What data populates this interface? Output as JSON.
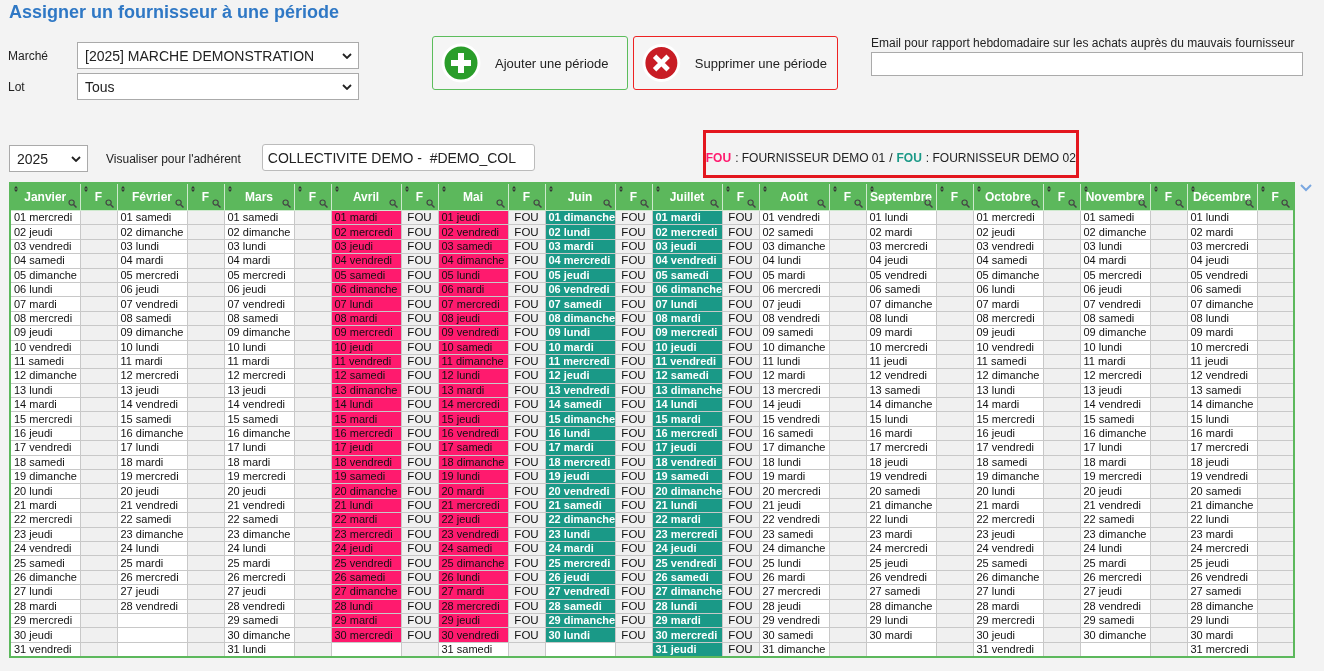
{
  "title": "Assigner un fournisseur à une période",
  "marche": {
    "label": "Marché",
    "value": "[2025] MARCHE DEMONSTRATION"
  },
  "lot": {
    "label": "Lot",
    "value": "Tous"
  },
  "buttons": [
    {
      "kind": "add",
      "label": "Ajouter une période"
    },
    {
      "kind": "remove",
      "label": "Supprimer une période"
    }
  ],
  "email": {
    "label": "Email pour rapport hebdomadaire sur les achats auprès du mauvais fournisseur"
  },
  "year": {
    "value": "2025"
  },
  "adherent": {
    "label": "Visualiser pour l'adhérent",
    "value": "COLLECTIVITE DEMO -  #DEMO_COL"
  },
  "legend": {
    "separator": "/",
    "items": [
      {
        "code": "FOU",
        "color": "#ff1a6e",
        "name": ": FOURNISSEUR DEMO 01"
      },
      {
        "code": "FOU",
        "color": "#1a9987",
        "name": ": FOURNISSEUR DEMO 02"
      }
    ]
  },
  "months": [
    {
      "name": "Janvier",
      "f_header": "F",
      "days": [
        "01 mercredi",
        "02 jeudi",
        "03 vendredi",
        "04 samedi",
        "05 dimanche",
        "06 lundi",
        "07 mardi",
        "08 mercredi",
        "09 jeudi",
        "10 vendredi",
        "11 samedi",
        "12 dimanche",
        "13 lundi",
        "14 mardi",
        "15 mercredi",
        "16 jeudi",
        "17 vendredi",
        "18 samedi",
        "19 dimanche",
        "20 lundi",
        "21 mardi",
        "22 mercredi",
        "23 jeudi",
        "24 vendredi",
        "25 samedi",
        "26 dimanche",
        "27 lundi",
        "28 mardi",
        "29 mercredi",
        "30 jeudi",
        "31 vendredi"
      ]
    },
    {
      "name": "Février",
      "f_header": "F",
      "days": [
        "01 samedi",
        "02 dimanche",
        "03 lundi",
        "04 mardi",
        "05 mercredi",
        "06 jeudi",
        "07 vendredi",
        "08 samedi",
        "09 dimanche",
        "10 lundi",
        "11 mardi",
        "12 mercredi",
        "13 jeudi",
        "14 vendredi",
        "15 samedi",
        "16 dimanche",
        "17 lundi",
        "18 mardi",
        "19 mercredi",
        "20 jeudi",
        "21 vendredi",
        "22 samedi",
        "23 dimanche",
        "24 lundi",
        "25 mardi",
        "26 mercredi",
        "27 jeudi",
        "28 vendredi"
      ]
    },
    {
      "name": "Mars",
      "f_header": "F",
      "days": [
        "01 samedi",
        "02 dimanche",
        "03 lundi",
        "04 mardi",
        "05 mercredi",
        "06 jeudi",
        "07 vendredi",
        "08 samedi",
        "09 dimanche",
        "10 lundi",
        "11 mardi",
        "12 mercredi",
        "13 jeudi",
        "14 vendredi",
        "15 samedi",
        "16 dimanche",
        "17 lundi",
        "18 mardi",
        "19 mercredi",
        "20 jeudi",
        "21 vendredi",
        "22 samedi",
        "23 dimanche",
        "24 lundi",
        "25 mardi",
        "26 mercredi",
        "27 jeudi",
        "28 vendredi",
        "29 samedi",
        "30 dimanche",
        "31 lundi"
      ]
    },
    {
      "name": "Avril",
      "f_header": "F",
      "color": "#ff1a6e",
      "days": [
        "01 mardi",
        "02 mercredi",
        "03 jeudi",
        "04 vendredi",
        "05 samedi",
        "06 dimanche",
        "07 lundi",
        "08 mardi",
        "09 mercredi",
        "10 jeudi",
        "11 vendredi",
        "12 samedi",
        "13 dimanche",
        "14 lundi",
        "15 mardi",
        "16 mercredi",
        "17 jeudi",
        "18 vendredi",
        "19 samedi",
        "20 dimanche",
        "21 lundi",
        "22 mardi",
        "23 mercredi",
        "24 jeudi",
        "25 vendredi",
        "26 samedi",
        "27 dimanche",
        "28 lundi",
        "29 mardi",
        "30 mercredi"
      ],
      "assigned": [
        "FOU",
        "FOU",
        "FOU",
        "FOU",
        "FOU",
        "FOU",
        "FOU",
        "FOU",
        "FOU",
        "FOU",
        "FOU",
        "FOU",
        "FOU",
        "FOU",
        "FOU",
        "FOU",
        "FOU",
        "FOU",
        "FOU",
        "FOU",
        "FOU",
        "FOU",
        "FOU",
        "FOU",
        "FOU",
        "FOU",
        "FOU",
        "FOU",
        "FOU",
        "FOU"
      ]
    },
    {
      "name": "Mai",
      "f_header": "F",
      "color": "#ff1a6e",
      "days": [
        "01 jeudi",
        "02 vendredi",
        "03 samedi",
        "04 dimanche",
        "05 lundi",
        "06 mardi",
        "07 mercredi",
        "08 jeudi",
        "09 vendredi",
        "10 samedi",
        "11 dimanche",
        "12 lundi",
        "13 mardi",
        "14 mercredi",
        "15 jeudi",
        "16 vendredi",
        "17 samedi",
        "18 dimanche",
        "19 lundi",
        "20 mardi",
        "21 mercredi",
        "22 jeudi",
        "23 vendredi",
        "24 samedi",
        "25 dimanche",
        "26 lundi",
        "27 mardi",
        "28 mercredi",
        "29 jeudi",
        "30 vendredi",
        "31 samedi"
      ],
      "assigned": [
        "FOU",
        "FOU",
        "FOU",
        "FOU",
        "FOU",
        "FOU",
        "FOU",
        "FOU",
        "FOU",
        "FOU",
        "FOU",
        "FOU",
        "FOU",
        "FOU",
        "FOU",
        "FOU",
        "FOU",
        "FOU",
        "FOU",
        "FOU",
        "FOU",
        "FOU",
        "FOU",
        "FOU",
        "FOU",
        "FOU",
        "FOU",
        "FOU",
        "FOU",
        "FOU"
      ]
    },
    {
      "name": "Juin",
      "f_header": "F",
      "color": "#1a9987",
      "days": [
        "01 dimanche",
        "02 lundi",
        "03 mardi",
        "04 mercredi",
        "05 jeudi",
        "06 vendredi",
        "07 samedi",
        "08 dimanche",
        "09 lundi",
        "10 mardi",
        "11 mercredi",
        "12 jeudi",
        "13 vendredi",
        "14 samedi",
        "15 dimanche",
        "16 lundi",
        "17 mardi",
        "18 mercredi",
        "19 jeudi",
        "20 vendredi",
        "21 samedi",
        "22 dimanche",
        "23 lundi",
        "24 mardi",
        "25 mercredi",
        "26 jeudi",
        "27 vendredi",
        "28 samedi",
        "29 dimanche",
        "30 lundi"
      ],
      "assigned": [
        "FOU",
        "FOU",
        "FOU",
        "FOU",
        "FOU",
        "FOU",
        "FOU",
        "FOU",
        "FOU",
        "FOU",
        "FOU",
        "FOU",
        "FOU",
        "FOU",
        "FOU",
        "FOU",
        "FOU",
        "FOU",
        "FOU",
        "FOU",
        "FOU",
        "FOU",
        "FOU",
        "FOU",
        "FOU",
        "FOU",
        "FOU",
        "FOU",
        "FOU",
        "FOU"
      ]
    },
    {
      "name": "Juillet",
      "f_header": "F",
      "color": "#1a9987",
      "days": [
        "01 mardi",
        "02 mercredi",
        "03 jeudi",
        "04 vendredi",
        "05 samedi",
        "06 dimanche",
        "07 lundi",
        "08 mardi",
        "09 mercredi",
        "10 jeudi",
        "11 vendredi",
        "12 samedi",
        "13 dimanche",
        "14 lundi",
        "15 mardi",
        "16 mercredi",
        "17 jeudi",
        "18 vendredi",
        "19 samedi",
        "20 dimanche",
        "21 lundi",
        "22 mardi",
        "23 mercredi",
        "24 jeudi",
        "25 vendredi",
        "26 samedi",
        "27 dimanche",
        "28 lundi",
        "29 mardi",
        "30 mercredi",
        "31 jeudi"
      ],
      "assigned": [
        "FOU",
        "FOU",
        "FOU",
        "FOU",
        "FOU",
        "FOU",
        "FOU",
        "FOU",
        "FOU",
        "FOU",
        "FOU",
        "FOU",
        "FOU",
        "FOU",
        "FOU",
        "FOU",
        "FOU",
        "FOU",
        "FOU",
        "FOU",
        "FOU",
        "FOU",
        "FOU",
        "FOU",
        "FOU",
        "FOU",
        "FOU",
        "FOU",
        "FOU",
        "FOU",
        "FOU"
      ]
    },
    {
      "name": "Août",
      "f_header": "F",
      "days": [
        "01 vendredi",
        "02 samedi",
        "03 dimanche",
        "04 lundi",
        "05 mardi",
        "06 mercredi",
        "07 jeudi",
        "08 vendredi",
        "09 samedi",
        "10 dimanche",
        "11 lundi",
        "12 mardi",
        "13 mercredi",
        "14 jeudi",
        "15 vendredi",
        "16 samedi",
        "17 dimanche",
        "18 lundi",
        "19 mardi",
        "20 mercredi",
        "21 jeudi",
        "22 vendredi",
        "23 samedi",
        "24 dimanche",
        "25 lundi",
        "26 mardi",
        "27 mercredi",
        "28 jeudi",
        "29 vendredi",
        "30 samedi",
        "31 dimanche"
      ]
    },
    {
      "name": "Septembre",
      "f_header": "F",
      "days": [
        "01 lundi",
        "02 mardi",
        "03 mercredi",
        "04 jeudi",
        "05 vendredi",
        "06 samedi",
        "07 dimanche",
        "08 lundi",
        "09 mardi",
        "10 mercredi",
        "11 jeudi",
        "12 vendredi",
        "13 samedi",
        "14 dimanche",
        "15 lundi",
        "16 mardi",
        "17 mercredi",
        "18 jeudi",
        "19 vendredi",
        "20 samedi",
        "21 dimanche",
        "22 lundi",
        "23 mardi",
        "24 mercredi",
        "25 jeudi",
        "26 vendredi",
        "27 samedi",
        "28 dimanche",
        "29 lundi",
        "30 mardi"
      ]
    },
    {
      "name": "Octobre",
      "f_header": "F",
      "days": [
        "01 mercredi",
        "02 jeudi",
        "03 vendredi",
        "04 samedi",
        "05 dimanche",
        "06 lundi",
        "07 mardi",
        "08 mercredi",
        "09 jeudi",
        "10 vendredi",
        "11 samedi",
        "12 dimanche",
        "13 lundi",
        "14 mardi",
        "15 mercredi",
        "16 jeudi",
        "17 vendredi",
        "18 samedi",
        "19 dimanche",
        "20 lundi",
        "21 mardi",
        "22 mercredi",
        "23 jeudi",
        "24 vendredi",
        "25 samedi",
        "26 dimanche",
        "27 lundi",
        "28 mardi",
        "29 mercredi",
        "30 jeudi",
        "31 vendredi"
      ]
    },
    {
      "name": "Novembre",
      "f_header": "F",
      "days": [
        "01 samedi",
        "02 dimanche",
        "03 lundi",
        "04 mardi",
        "05 mercredi",
        "06 jeudi",
        "07 vendredi",
        "08 samedi",
        "09 dimanche",
        "10 lundi",
        "11 mardi",
        "12 mercredi",
        "13 jeudi",
        "14 vendredi",
        "15 samedi",
        "16 dimanche",
        "17 lundi",
        "18 mardi",
        "19 mercredi",
        "20 jeudi",
        "21 vendredi",
        "22 samedi",
        "23 dimanche",
        "24 lundi",
        "25 mardi",
        "26 mercredi",
        "27 jeudi",
        "28 vendredi",
        "29 samedi",
        "30 dimanche"
      ]
    },
    {
      "name": "Décembre",
      "f_header": "F",
      "days": [
        "01 lundi",
        "02 mardi",
        "03 mercredi",
        "04 jeudi",
        "05 vendredi",
        "06 samedi",
        "07 dimanche",
        "08 lundi",
        "09 mardi",
        "10 mercredi",
        "11 jeudi",
        "12 vendredi",
        "13 samedi",
        "14 dimanche",
        "15 lundi",
        "16 mardi",
        "17 mercredi",
        "18 jeudi",
        "19 vendredi",
        "20 samedi",
        "21 dimanche",
        "22 lundi",
        "23 mardi",
        "24 mercredi",
        "25 jeudi",
        "26 vendredi",
        "27 samedi",
        "28 dimanche",
        "29 lundi",
        "30 mardi",
        "31 mercredi"
      ]
    }
  ]
}
